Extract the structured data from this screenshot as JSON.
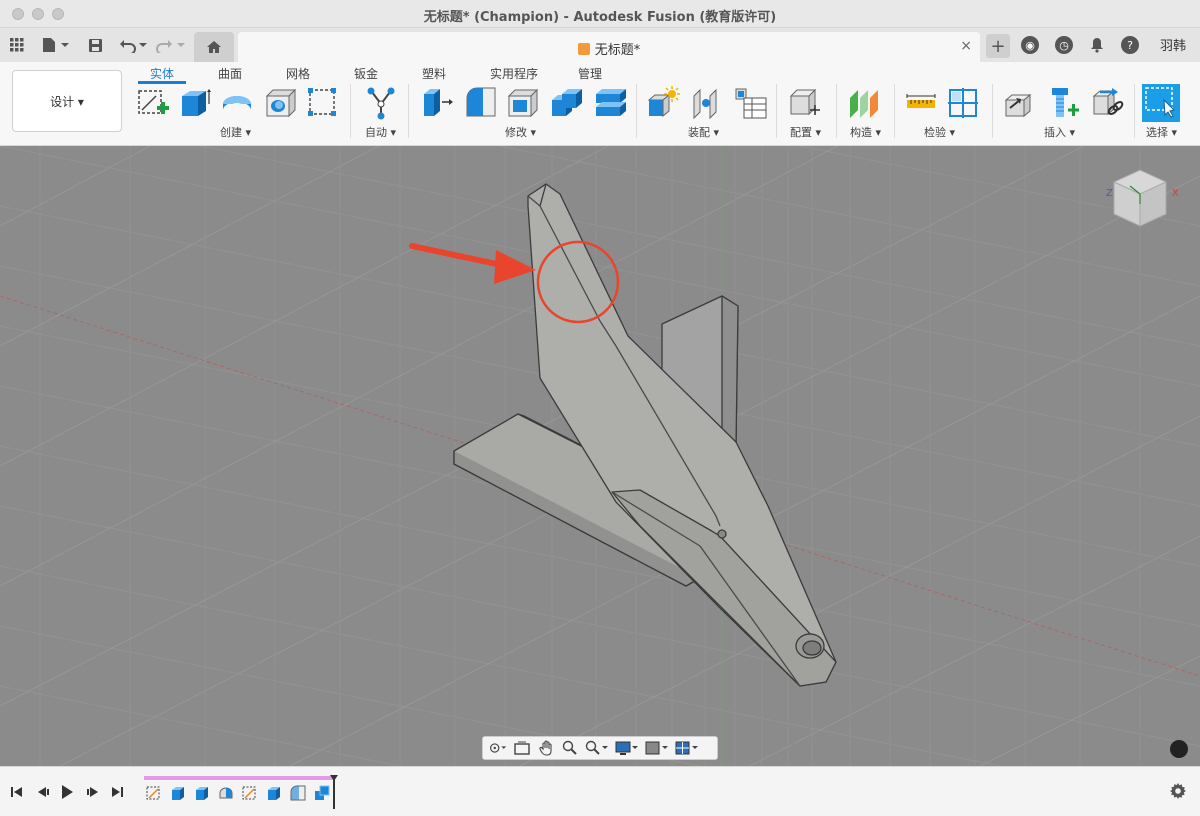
{
  "window": {
    "title": "无标题* (Champion) - Autodesk Fusion (教育版许可)"
  },
  "tabbar": {
    "document_tab": "无标题*",
    "close_glyph": "×",
    "new_tab_glyph": "+",
    "user_name": "羽韩",
    "icons": [
      "app-grid-icon",
      "file-icon",
      "save-icon",
      "undo-icon",
      "redo-icon",
      "home-icon",
      "job-status-icon",
      "clock-icon",
      "notification-bell-icon",
      "help-icon"
    ]
  },
  "ribbon": {
    "workspace_label": "设计 ▾",
    "tabs": [
      "实体",
      "曲面",
      "网格",
      "钣金",
      "塑料",
      "实用程序",
      "管理"
    ],
    "active_tab": "实体",
    "groups": [
      {
        "label": "创建 ▾"
      },
      {
        "label": "自动 ▾"
      },
      {
        "label": "修改 ▾"
      },
      {
        "label": "装配 ▾"
      },
      {
        "label": "配置 ▾"
      },
      {
        "label": "构造 ▾"
      },
      {
        "label": "检验 ▾"
      },
      {
        "label": "插入 ▾"
      },
      {
        "label": "选择 ▾"
      }
    ]
  },
  "viewport": {
    "background_color": "#8b8b8b",
    "viewcube_axes": {
      "z": "Z",
      "x": "X"
    },
    "annotation_color": "#e8452c",
    "nav_tools": [
      "orbit-icon",
      "look-at-icon",
      "pan-icon",
      "zoom-icon",
      "zoom-window-icon",
      "display-settings-icon",
      "visual-style-icon",
      "grid-icon",
      "viewports-icon"
    ]
  },
  "timeline": {
    "controls": [
      "go-to-start-icon",
      "step-back-icon",
      "play-icon",
      "step-forward-icon",
      "go-to-end-icon"
    ],
    "features": [
      "sketch-icon",
      "extrude-icon",
      "extrude-icon",
      "revolve-icon",
      "sketch-icon",
      "extrude-icon",
      "fillet-icon",
      "combine-icon"
    ],
    "track_color": "#e59ae8"
  }
}
